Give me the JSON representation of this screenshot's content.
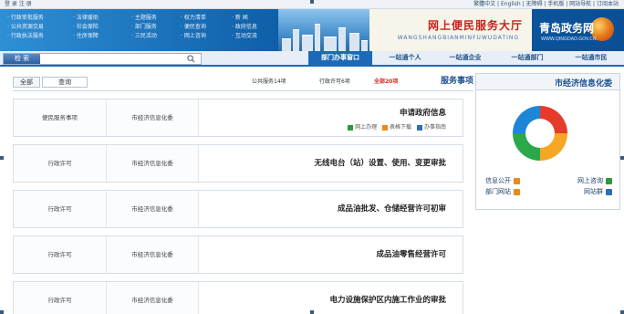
{
  "topbar": {
    "left_text": "登 录  注 册",
    "right_text": "繁體中文 | English | 无障碍 | 手机版 | 网站导航 | 订阅本站"
  },
  "banner": {
    "links": [
      [
        "· 行政审批服务",
        "· 公共资源交易",
        "· 行政执法服务"
      ],
      [
        "· 法律援助",
        "· 社会保险",
        "· 住房保障"
      ],
      [
        "· 主题服务",
        "· 部门服务",
        "· 三民活动"
      ],
      [
        "· 权力清单",
        "· 便民查询",
        "· 网上咨询"
      ],
      [
        "· 新 闻",
        "· 政府信息",
        "· 互动交流"
      ]
    ],
    "title": "网上便民服务大厅",
    "subtitle": "WANGSHANGBIANMINFUWUDATING",
    "site_name": "青岛政务网",
    "site_sub": "WWW.QINGDAO.GOV.CN"
  },
  "search": {
    "button": "检 索",
    "placeholder": ""
  },
  "tabs": [
    {
      "label": "部门办事窗口",
      "active": true
    },
    {
      "label": "一站通个人",
      "active": false
    },
    {
      "label": "一站通企业",
      "active": false
    },
    {
      "label": "一站通部门",
      "active": false
    },
    {
      "label": "一站通市民",
      "active": false
    }
  ],
  "filter": {
    "all_label": "全部",
    "search_label": "查询",
    "heading": "服务事项",
    "total": "全部20项",
    "admin_permit": "行政许可6项",
    "public_service": "公共服务14项"
  },
  "items": [
    {
      "title": "申请政府信息",
      "subs": [
        "网上办理",
        "表格下载",
        "办事指南"
      ],
      "dept": "市经济信息化委",
      "type": "便民服务事项"
    },
    {
      "title": "无线电台（站）设置、使用、变更审批",
      "subs": [],
      "dept": "市经济信息化委",
      "type": "行政许可"
    },
    {
      "title": "成品油批发、仓储经营许可初审",
      "subs": [],
      "dept": "市经济信息化委",
      "type": "行政许可"
    },
    {
      "title": "成品油零售经营许可",
      "subs": [],
      "dept": "市经济信息化委",
      "type": "行政许可"
    },
    {
      "title": "电力设施保护区内施工作业的审批",
      "subs": [],
      "dept": "市经济信息化委",
      "type": "行政许可"
    }
  ],
  "side": {
    "heading": "市经济信息化委",
    "links": [
      {
        "label": "网上咨询",
        "color": "#2b9a3b"
      },
      {
        "label": "信息公开",
        "color": "#e98a1d"
      },
      {
        "label": "网站群",
        "color": "#2c6fb9"
      },
      {
        "label": "部门网站",
        "color": "#e98a1d"
      }
    ]
  },
  "colors": {
    "brand_blue": "#1c69b8",
    "title_red": "#c8221b",
    "accent_orange": "#e98a1d"
  }
}
